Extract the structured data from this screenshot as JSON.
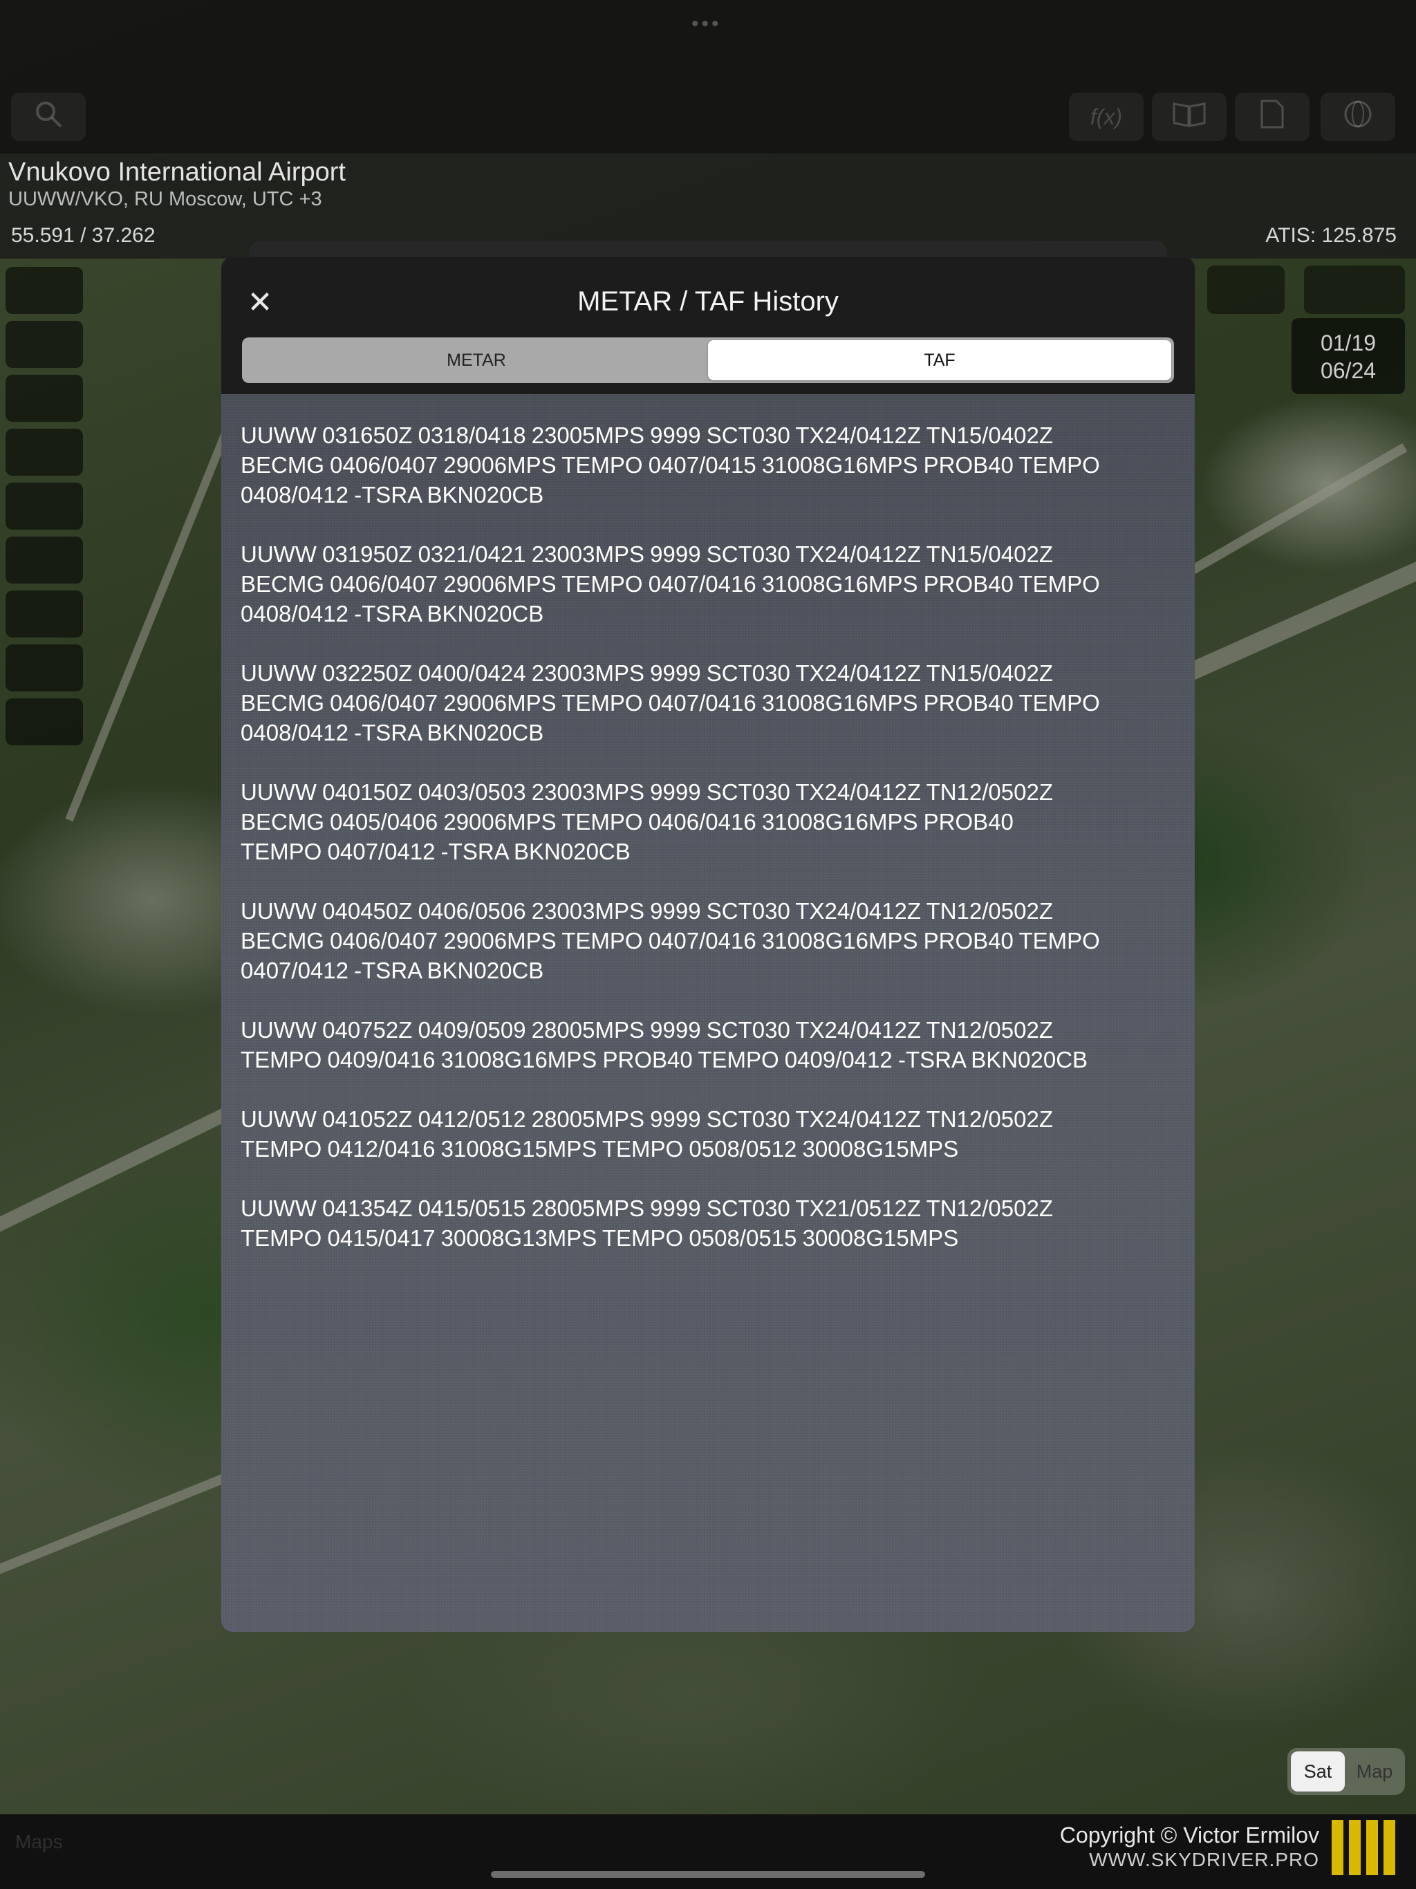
{
  "map": {
    "airport_name": "Vnukovo International Airport",
    "airport_subtitle": "UUWW/VKO, RU Moscow, UTC +3",
    "coordinates": "55.591 / 37.262",
    "atis": "ATIS: 125.875",
    "date_top": "01/19",
    "date_bottom": "06/24",
    "toggle": {
      "sat": "Sat",
      "map": "Map",
      "selected": "Sat"
    },
    "maps_logo": "Maps"
  },
  "toolbar": {
    "icons": [
      "search-icon",
      "function-icon",
      "book-icon",
      "document-icon",
      "globe-icon"
    ]
  },
  "footer": {
    "copyright": "Copyright © Victor Ermilov",
    "website": "WWW.SKYDRIVER.PRO",
    "brand_color": "#d9b800"
  },
  "modal": {
    "title": "METAR / TAF History",
    "close_glyph": "✕",
    "tabs": [
      {
        "label": "METAR",
        "active": false
      },
      {
        "label": "TAF",
        "active": true
      }
    ],
    "entries": [
      "UUWW 031650Z 0318/0418 23005MPS 9999 SCT030 TX24/0412Z TN15/0402Z\nBECMG 0406/0407 29006MPS TEMPO 0407/0415 31008G16MPS PROB40 TEMPO\n0408/0412 -TSRA BKN020CB",
      "UUWW 031950Z 0321/0421 23003MPS 9999 SCT030 TX24/0412Z TN15/0402Z\nBECMG 0406/0407 29006MPS TEMPO 0407/0416 31008G16MPS PROB40 TEMPO\n0408/0412 -TSRA BKN020CB",
      "UUWW 032250Z 0400/0424 23003MPS 9999 SCT030 TX24/0412Z TN15/0402Z\nBECMG 0406/0407 29006MPS TEMPO 0407/0416 31008G16MPS PROB40 TEMPO\n0408/0412 -TSRA BKN020CB",
      "UUWW 040150Z 0403/0503 23003MPS 9999 SCT030 TX24/0412Z TN12/0502Z\nBECMG 0405/0406 29006MPS TEMPO 0406/0416 31008G16MPS PROB40\nTEMPO 0407/0412 -TSRA BKN020CB",
      "UUWW 040450Z 0406/0506 23003MPS 9999 SCT030 TX24/0412Z TN12/0502Z\nBECMG 0406/0407 29006MPS TEMPO 0407/0416 31008G16MPS PROB40 TEMPO\n0407/0412 -TSRA BKN020CB",
      "UUWW 040752Z 0409/0509 28005MPS 9999 SCT030 TX24/0412Z TN12/0502Z\nTEMPO 0409/0416 31008G16MPS PROB40 TEMPO 0409/0412 -TSRA BKN020CB",
      "UUWW 041052Z 0412/0512 28005MPS 9999 SCT030 TX24/0412Z TN12/0502Z\nTEMPO 0412/0416 31008G15MPS TEMPO 0508/0512 30008G15MPS",
      "UUWW 041354Z 0415/0515 28005MPS 9999 SCT030 TX21/0512Z TN12/0502Z\nTEMPO 0415/0417 30008G13MPS TEMPO 0508/0515 30008G15MPS"
    ]
  }
}
